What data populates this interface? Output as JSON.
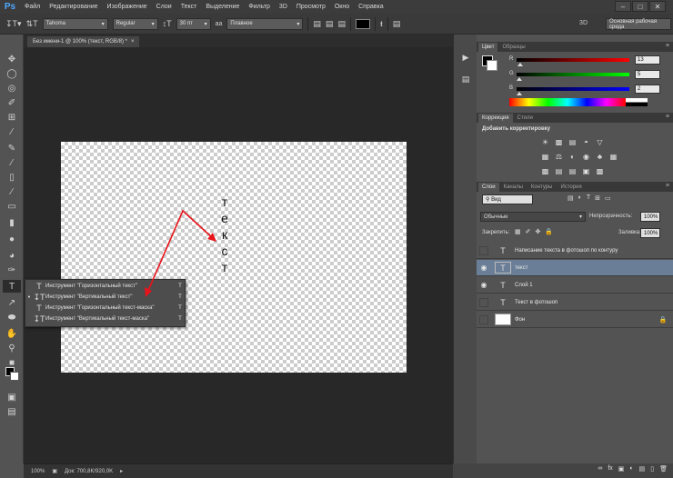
{
  "app": {
    "logo": "Ps"
  },
  "menu": [
    "Файл",
    "Редактирование",
    "Изображение",
    "Слои",
    "Текст",
    "Выделение",
    "Фильтр",
    "3D",
    "Просмотр",
    "Окно",
    "Справка"
  ],
  "options": {
    "font_family": "Tahoma",
    "font_style": "Regular",
    "font_size": "30 пт",
    "antialias_label": "аа",
    "antialias": "Плавное",
    "label_3d": "3D",
    "workspace": "Основная рабочая среда"
  },
  "document": {
    "tab_title": "Без имени-1 @ 100% (текст, RGB/8) *",
    "vertical_text": [
      "т",
      "е",
      "к",
      "с",
      "т"
    ],
    "zoom": "100%",
    "doc_info": "Док: 700,8K/920,0K"
  },
  "flyout": {
    "items": [
      {
        "label": "Инструмент \"Горизонтальный текст\"",
        "key": "T",
        "active": false
      },
      {
        "label": "Инструмент \"Вертикальный текст\"",
        "key": "T",
        "active": true
      },
      {
        "label": "Инструмент \"Горизонтальный текст-маска\"",
        "key": "T",
        "active": false
      },
      {
        "label": "Инструмент \"Вертикальный текст-маска\"",
        "key": "T",
        "active": false
      }
    ]
  },
  "color_panel": {
    "tabs": [
      "Цвет",
      "Образцы"
    ],
    "r_label": "R",
    "g_label": "G",
    "b_label": "B",
    "r_value": "13",
    "g_value": "5",
    "b_value": "2"
  },
  "adjustments": {
    "tabs": [
      "Коррекция",
      "Стили"
    ],
    "title": "Добавить корректировку"
  },
  "layers_panel": {
    "tabs": [
      "Слои",
      "Каналы",
      "Контуры",
      "История"
    ],
    "filter": "Вид",
    "blend_mode": "Обычные",
    "opacity_label": "Непрозрачность:",
    "opacity": "100%",
    "lock_label": "Закрепить:",
    "fill_label": "Заливка:",
    "fill": "100%",
    "layers": [
      {
        "name": "Написание текста в фотошоп по контуру",
        "type": "text",
        "visible": false,
        "selected": false
      },
      {
        "name": "текст",
        "type": "text",
        "visible": true,
        "selected": true
      },
      {
        "name": "Слой 1",
        "type": "text",
        "visible": true,
        "selected": false
      },
      {
        "name": "Текст в фотошоп",
        "type": "text",
        "visible": false,
        "selected": false
      },
      {
        "name": "Фон",
        "type": "fill",
        "visible": false,
        "selected": false
      }
    ]
  },
  "colors": {
    "selection": "#6a7f97",
    "arrow": "#e8141b",
    "logo": "#4fa8ff"
  }
}
